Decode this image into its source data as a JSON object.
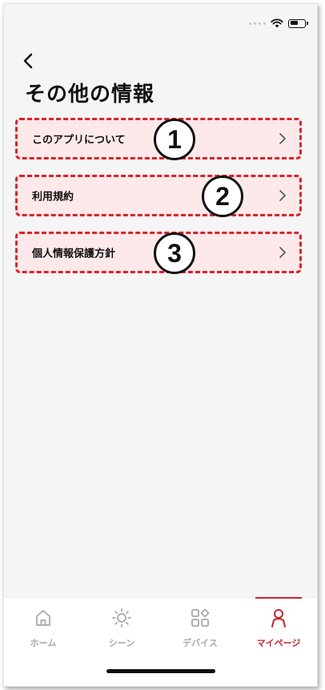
{
  "status_bar": {
    "wifi_icon": "wifi-icon",
    "battery_icon": "battery-icon"
  },
  "header": {
    "back_icon": "back-arrow-icon",
    "title": "その他の情報"
  },
  "menu": {
    "items": [
      {
        "label": "このアプリについて",
        "badge": "1",
        "icon": "chevron-right-icon"
      },
      {
        "label": "利用規約",
        "badge": "2",
        "icon": "chevron-right-icon"
      },
      {
        "label": "個人情報保護方針",
        "badge": "3",
        "icon": "chevron-right-icon"
      }
    ]
  },
  "bottom_nav": {
    "items": [
      {
        "label": "ホーム",
        "icon": "home-icon",
        "active": false
      },
      {
        "label": "シーン",
        "icon": "sun-icon",
        "active": false
      },
      {
        "label": "デバイス",
        "icon": "devices-grid-icon",
        "active": false
      },
      {
        "label": "マイページ",
        "icon": "person-icon",
        "active": true
      }
    ]
  },
  "colors": {
    "accent": "#c8232a",
    "highlight_border": "#d9232b",
    "highlight_fill": "#fde9ea",
    "background": "#f5f5f5"
  }
}
